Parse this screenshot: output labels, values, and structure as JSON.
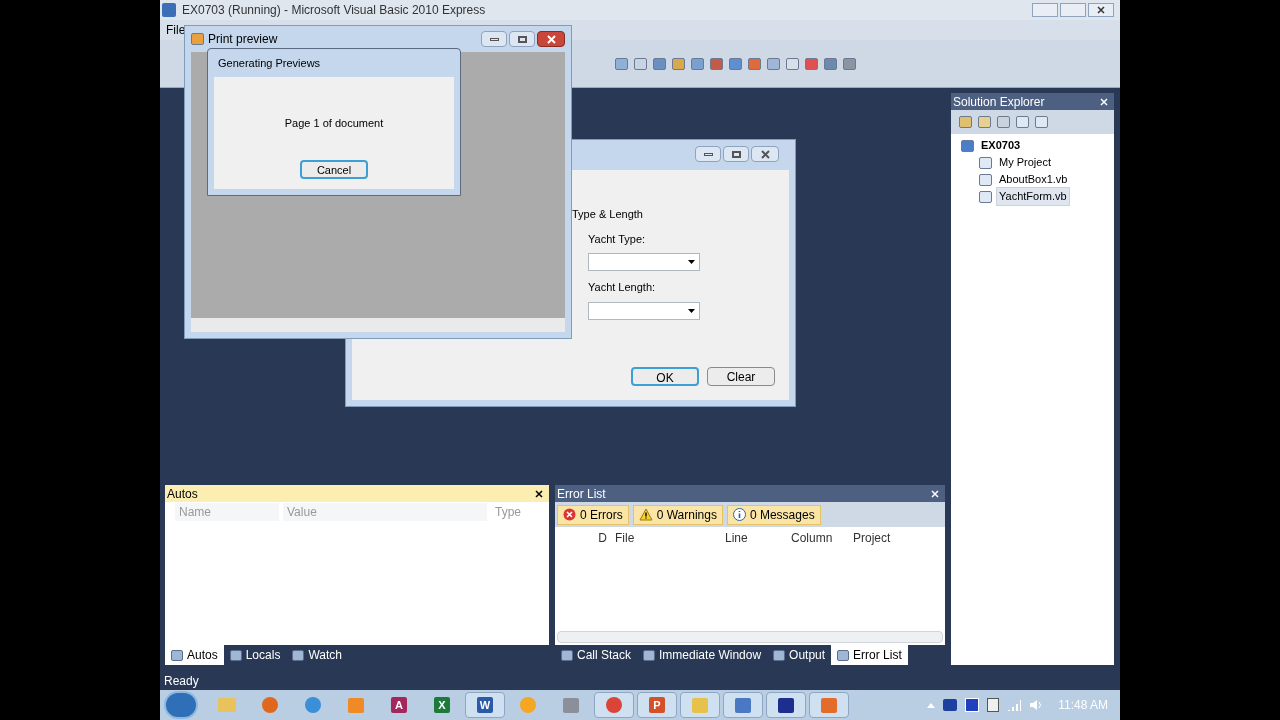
{
  "ide": {
    "title": "EX0703 (Running) - Microsoft Visual Basic 2010 Express",
    "menu": [
      "File"
    ]
  },
  "print_preview": {
    "title": "Print preview"
  },
  "progress_dialog": {
    "title": "Generating Previews",
    "message": "Page 1 of document",
    "button": "Cancel"
  },
  "yacht_form": {
    "group": "Type & Length",
    "fields": [
      {
        "label": "Yacht Type:"
      },
      {
        "label": "Yacht Length:"
      }
    ],
    "buttons": [
      {
        "label": "OK",
        "default": true
      },
      {
        "label": "Clear",
        "default": false
      }
    ]
  },
  "solution_explorer": {
    "title": "Solution Explorer",
    "tree": [
      {
        "label": "EX0703",
        "children": [
          {
            "label": "My Project",
            "selected": false
          },
          {
            "label": "AboutBox1.vb",
            "selected": false
          },
          {
            "label": "YachtForm.vb",
            "selected": true
          }
        ]
      }
    ]
  },
  "autos": {
    "title": "Autos",
    "columns": [
      "Name",
      "Value",
      "Type"
    ],
    "tabs": [
      {
        "label": "Autos",
        "selected": true
      },
      {
        "label": "Locals",
        "selected": false
      },
      {
        "label": "Watch",
        "selected": false
      }
    ]
  },
  "error_list": {
    "title": "Error List",
    "filters": [
      {
        "kind": "error",
        "label": "0 Errors"
      },
      {
        "kind": "warning",
        "label": "0 Warnings"
      },
      {
        "kind": "info",
        "label": "0 Messages"
      }
    ],
    "columns": [
      "D",
      "File",
      "Line",
      "Column",
      "Project"
    ],
    "tabs": [
      {
        "label": "Call Stack",
        "selected": false
      },
      {
        "label": "Immediate Window",
        "selected": false
      },
      {
        "label": "Output",
        "selected": false
      },
      {
        "label": "Error List",
        "selected": true
      }
    ]
  },
  "status_bar": "Ready",
  "taskbar": {
    "apps": [
      {
        "kind": "folder",
        "color": "#e8c25a",
        "selected": false
      },
      {
        "kind": "round",
        "color": "#e0681c",
        "selected": false
      },
      {
        "kind": "round",
        "color": "#3b8fd9",
        "selected": false
      },
      {
        "kind": "square",
        "color": "#f08a24",
        "selected": false
      },
      {
        "kind": "letter",
        "letter": "A",
        "color": "#a4275b",
        "selected": false
      },
      {
        "kind": "letter",
        "letter": "X",
        "color": "#1e7a3c",
        "selected": false
      },
      {
        "kind": "letter",
        "letter": "W",
        "color": "#2a5aa8",
        "selected": true
      },
      {
        "kind": "round",
        "color": "#f5a623",
        "selected": false
      },
      {
        "kind": "square",
        "color": "#8a8f99",
        "selected": false
      },
      {
        "kind": "round",
        "color": "#db4437",
        "selected": true
      },
      {
        "kind": "letter",
        "letter": "P",
        "color": "#d2512b",
        "selected": true
      },
      {
        "kind": "square",
        "color": "#e6c24a",
        "selected": true
      },
      {
        "kind": "square",
        "color": "#4a78c2",
        "selected": true
      },
      {
        "kind": "square",
        "color": "#1c2f8f",
        "selected": true
      },
      {
        "kind": "square",
        "color": "#e36c2a",
        "selected": true
      }
    ],
    "clock": "11:48 AM"
  }
}
